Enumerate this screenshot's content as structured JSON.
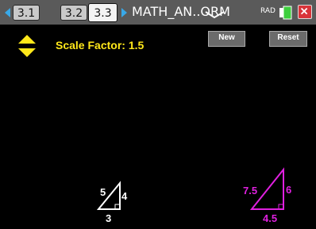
{
  "tabs": [
    {
      "label": "3.1"
    },
    {
      "label": "3.2"
    },
    {
      "label": "3.3",
      "active": true
    }
  ],
  "document": {
    "title": "MATH_AN..ORM"
  },
  "status": {
    "mode": "RAD"
  },
  "toolbar": {
    "new_label": "New",
    "reset_label": "Reset"
  },
  "scale": {
    "label": "Scale Factor: 1.5"
  },
  "original_triangle": {
    "hyp": "5",
    "vertical": "4",
    "base": "3",
    "color": "#ffffff"
  },
  "scaled_triangle": {
    "hyp": "7.5",
    "vertical": "6",
    "base": "4.5",
    "color": "#e020e0"
  },
  "colors": {
    "accent": "#ffe81a",
    "arrow": "#39a9e8",
    "close": "#d9343a"
  }
}
